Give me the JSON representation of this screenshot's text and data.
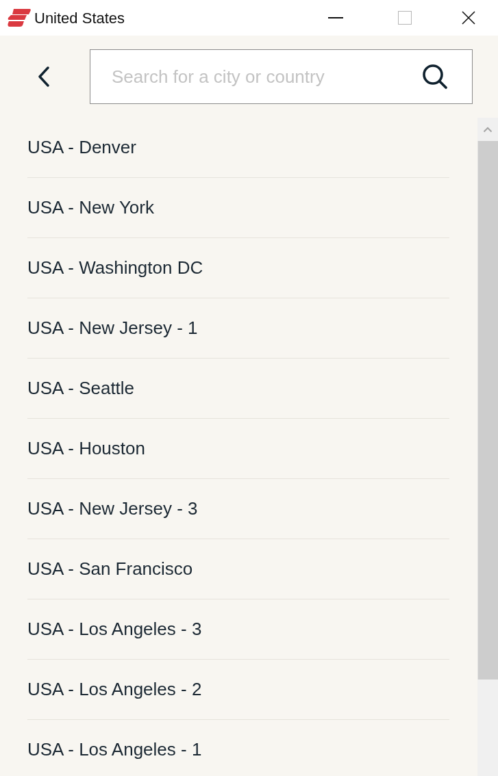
{
  "window": {
    "title": "United States"
  },
  "search": {
    "placeholder": "Search for a city or country"
  },
  "locations": [
    {
      "label": "USA - Denver"
    },
    {
      "label": "USA - New York"
    },
    {
      "label": "USA - Washington DC"
    },
    {
      "label": "USA - New Jersey - 1"
    },
    {
      "label": "USA - Seattle"
    },
    {
      "label": "USA - Houston"
    },
    {
      "label": "USA - New Jersey - 3"
    },
    {
      "label": "USA - San Francisco"
    },
    {
      "label": "USA - Los Angeles - 3"
    },
    {
      "label": "USA - Los Angeles - 2"
    },
    {
      "label": "USA - Los Angeles - 1"
    }
  ]
}
